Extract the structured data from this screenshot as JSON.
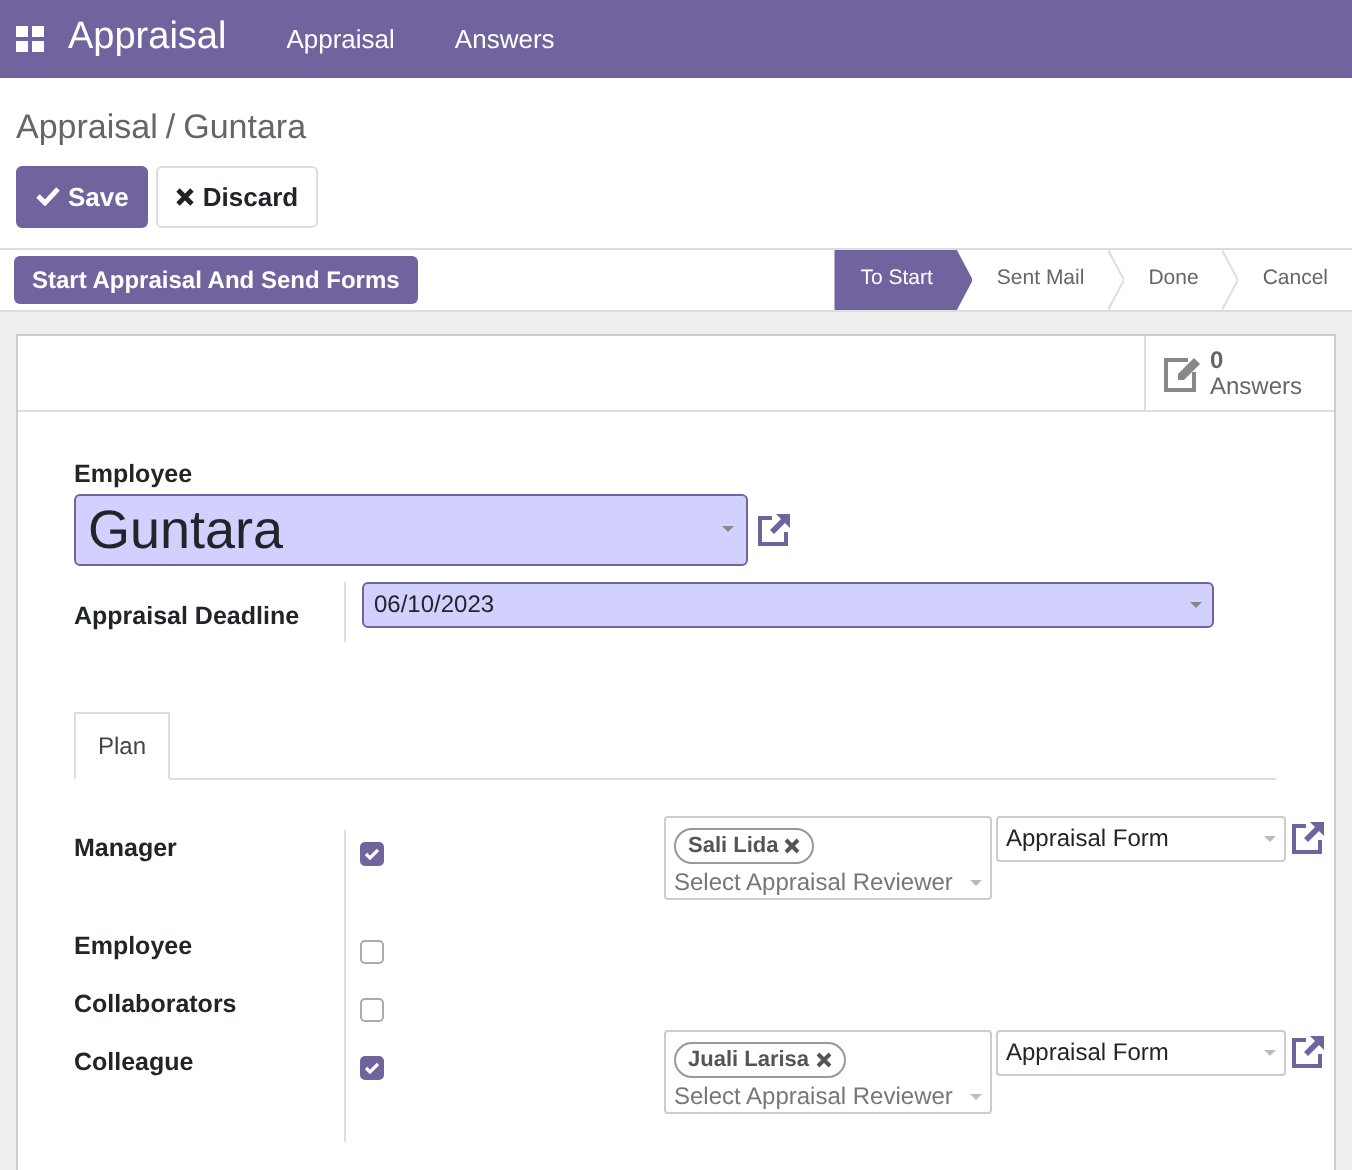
{
  "navbar": {
    "app_title": "Appraisal",
    "menu": [
      {
        "label": "Appraisal"
      },
      {
        "label": "Answers"
      }
    ]
  },
  "breadcrumb": {
    "parent": "Appraisal",
    "separator": "/",
    "current": "Guntara"
  },
  "buttons": {
    "save": "Save",
    "discard": "Discard"
  },
  "action_button": "Start Appraisal And Send Forms",
  "stages": [
    {
      "label": "To Start",
      "selected": true
    },
    {
      "label": "Sent Mail",
      "selected": false
    },
    {
      "label": "Done",
      "selected": false
    },
    {
      "label": "Cancel",
      "selected": false
    }
  ],
  "answers_button": {
    "count": "0",
    "label": "Answers"
  },
  "employee": {
    "label": "Employee",
    "value": "Guntara"
  },
  "deadline": {
    "label": "Appraisal Deadline",
    "value": "06/10/2023"
  },
  "tabs": [
    {
      "label": "Plan",
      "selected": true
    }
  ],
  "plan_rows": [
    {
      "label": "Manager",
      "checked": true,
      "reviewers": {
        "tags": [
          "Sali Lida"
        ],
        "placeholder": "Select Appraisal Reviewer",
        "form": "Appraisal Form"
      }
    },
    {
      "label": "Employee",
      "checked": false
    },
    {
      "label": "Collaborators",
      "checked": false
    },
    {
      "label": "Colleague",
      "checked": true,
      "reviewers": {
        "tags": [
          "Juali Larisa"
        ],
        "placeholder": "Select Appraisal Reviewer",
        "form": "Appraisal Form"
      }
    }
  ]
}
